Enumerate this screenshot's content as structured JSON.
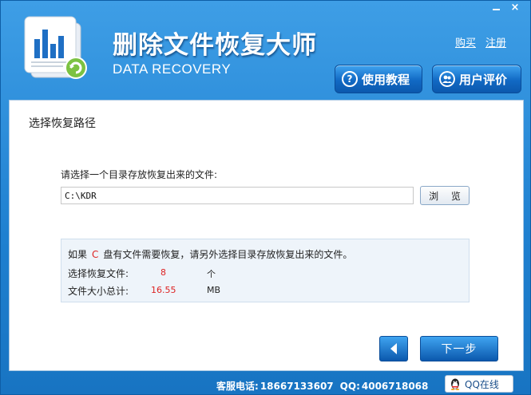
{
  "window": {
    "minimize_label": "—",
    "close_label": "×"
  },
  "header": {
    "title": "删除文件恢复大师",
    "subtitle": "DATA RECOVERY",
    "links": {
      "buy": "购买",
      "register": "注册"
    },
    "buttons": {
      "tutorial": "使用教程",
      "review": "用户评价"
    }
  },
  "content": {
    "section_title": "选择恢复路径",
    "prompt": "请选择一个目录存放恢复出来的文件:",
    "path_value": "C:\\KDR",
    "browse_label": "浏 览",
    "info": {
      "note_prefix": "如果",
      "note_drive": "C",
      "note_suffix": "盘有文件需要恢复，请另外选择目录存放恢复出来的文件。",
      "selected_label": "选择恢复文件:",
      "selected_value": "8",
      "selected_unit": "个",
      "size_label": "文件大小总计:",
      "size_value": "16.55",
      "size_unit": "MB"
    }
  },
  "nav": {
    "next_label": "下一步"
  },
  "footer": {
    "phone_label": "客服电话:",
    "phone_value": "18667133607",
    "qq_label": "QQ:",
    "qq_value": "4006718068",
    "qq_button": "QQ在线"
  },
  "colors": {
    "accent": "#1f80d0",
    "highlight": "#dd2222"
  }
}
